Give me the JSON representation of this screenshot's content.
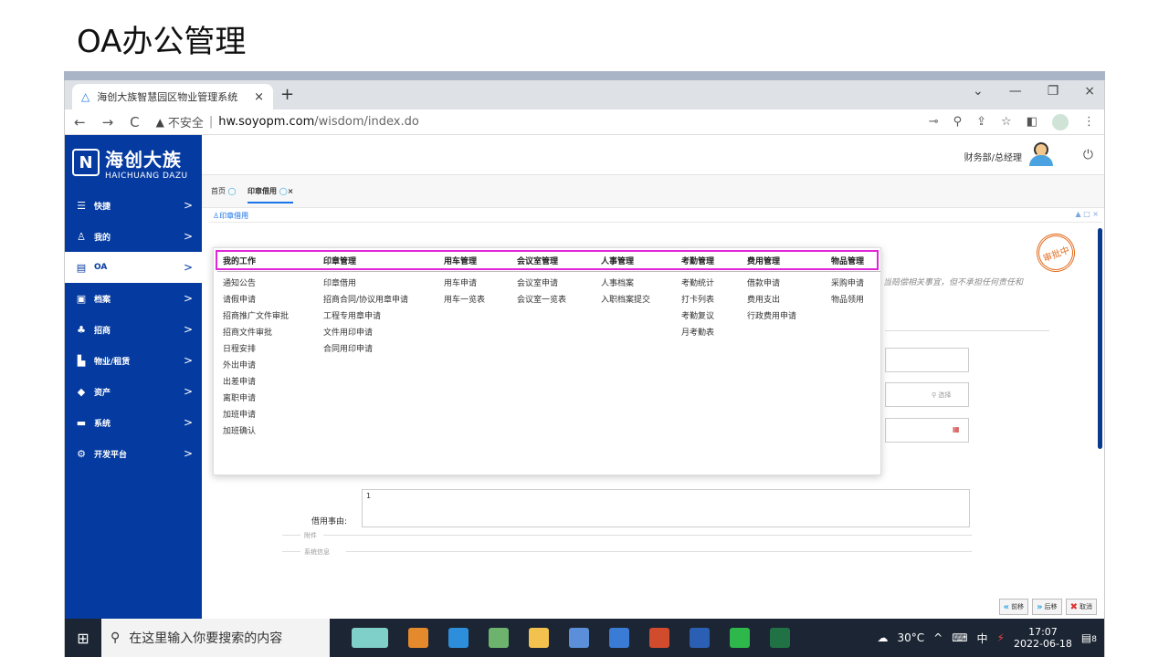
{
  "slide": {
    "title": "OA办公管理"
  },
  "browser": {
    "tab_title": "海创大族智慧园区物业管理系统",
    "tab_close": "×",
    "new_tab": "+",
    "back": "←",
    "forward": "→",
    "reload": "C",
    "insecure_label": "不安全",
    "url_host": "hw.soyopm.com",
    "url_path": "/wisdom/index.do",
    "win_min": "—",
    "win_restore": "❐",
    "win_close": "×",
    "win_chevron": "⌄"
  },
  "app": {
    "logo_cn": "海创大族",
    "logo_en": "HAICHUANG DAZU",
    "user_dept": "财务部/总经理",
    "power": "⏻",
    "page_tabs": [
      {
        "label": "首页"
      },
      {
        "label": "印章借用"
      }
    ],
    "breadcrumb": "印章借用",
    "crumb_controls": "▲ □ ×",
    "sidebar": [
      {
        "icon": "☰",
        "label": "快捷"
      },
      {
        "icon": "♙",
        "label": "我的"
      },
      {
        "icon": "▤",
        "label": "OA"
      },
      {
        "icon": "▣",
        "label": "档案"
      },
      {
        "icon": "♣",
        "label": "招商"
      },
      {
        "icon": "▙",
        "label": "物业/租赁"
      },
      {
        "icon": "◆",
        "label": "资产"
      },
      {
        "icon": "▬",
        "label": "系统"
      },
      {
        "icon": "⚙",
        "label": "开发平台"
      }
    ],
    "bg_text": "当赔偿相关事宜，但不承担任何责任和",
    "stamp_text": "审批中",
    "reason_label": "借用事由:",
    "reason_value": "1",
    "select_btn": "选择",
    "section_attach": "附件",
    "section_sysinfo": "系统信息",
    "buttons": {
      "prev": "前移",
      "next": "后移",
      "cancel": "取消"
    }
  },
  "menu": {
    "columns": [
      {
        "header": "我的工作",
        "items": [
          "通知公告",
          "请假申请",
          "招商推广文件审批",
          "招商文件审批",
          "日程安排",
          "外出申请",
          "出差申请",
          "离职申请",
          "加班申请",
          "加班确认"
        ]
      },
      {
        "header": "印章管理",
        "items": [
          "印章借用",
          "招商合同/协议用章申请",
          "工程专用章申请",
          "文件用印申请",
          "合同用印申请"
        ]
      },
      {
        "header": "用车管理",
        "items": [
          "用车申请",
          "用车一览表"
        ]
      },
      {
        "header": "会议室管理",
        "items": [
          "会议室申请",
          "会议室一览表"
        ]
      },
      {
        "header": "人事管理",
        "items": [
          "人事档案",
          "入职档案提交"
        ]
      },
      {
        "header": "考勤管理",
        "items": [
          "考勤统计",
          "打卡列表",
          "考勤复议",
          "月考勤表"
        ]
      },
      {
        "header": "费用管理",
        "items": [
          "借款申请",
          "费用支出",
          "行政费用申请"
        ]
      },
      {
        "header": "物品管理",
        "items": [
          "采购申请",
          "物品领用"
        ]
      }
    ]
  },
  "taskbar": {
    "search_placeholder": "在这里输入你要搜索的内容",
    "weather": "30°C",
    "ime": "中",
    "time": "17:07",
    "date": "2022-06-18",
    "notifications": "8"
  },
  "colors": {
    "brand": "#053ba0",
    "highlight": "#e026d9",
    "stamp": "#e46c1f"
  }
}
